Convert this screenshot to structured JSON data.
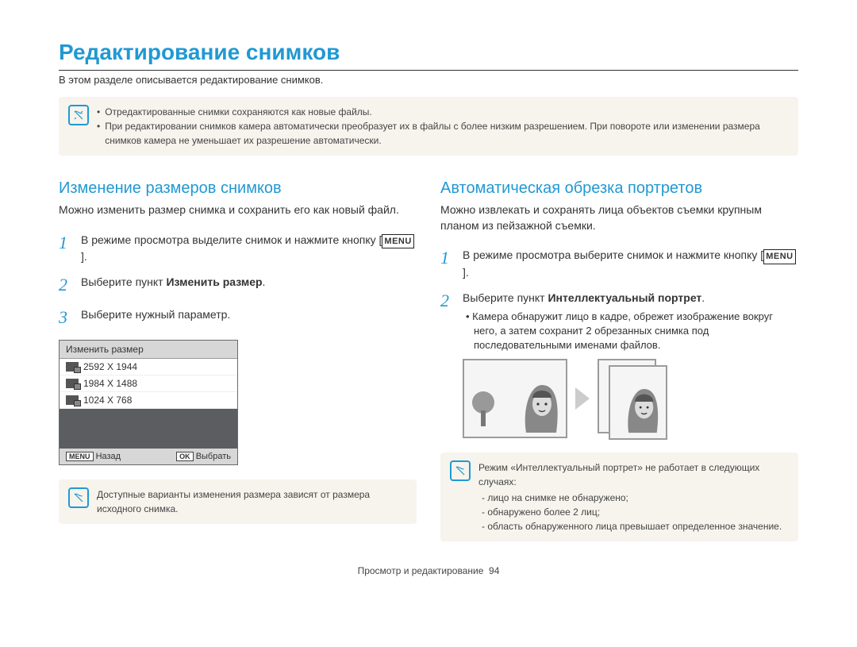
{
  "title": "Редактирование снимков",
  "subtitle": "В этом разделе описывается редактирование снимков.",
  "top_note": {
    "lines": [
      "Отредактированные снимки сохраняются как новые файлы.",
      "При редактировании снимков камера автоматически преобразует их в файлы с более низким разрешением. При повороте или изменении размера снимков камера не уменьшает их разрешение автоматически."
    ]
  },
  "left": {
    "heading": "Изменение размеров снимков",
    "lead": "Можно изменить размер снимка и сохранить его как новый файл.",
    "steps": [
      {
        "pre": "В режиме просмотра выделите снимок и нажмите кнопку [",
        "key": "MENU",
        "post": "]."
      },
      {
        "pre": "Выберите пункт ",
        "bold": "Изменить размер",
        "post": "."
      },
      {
        "pre": "Выберите нужный параметр."
      }
    ],
    "cam": {
      "title": "Изменить размер",
      "rows": [
        "2592 X 1944",
        "1984 X 1488",
        "1024 X 768"
      ],
      "foot_left_key": "MENU",
      "foot_left": "Назад",
      "foot_right_key": "OK",
      "foot_right": "Выбрать"
    },
    "note": "Доступные варианты изменения размера зависят от размера исходного снимка."
  },
  "right": {
    "heading": "Автоматическая обрезка портретов",
    "lead": "Можно извлекать и сохранять лица объектов съемки крупным планом из пейзажной съемки.",
    "steps": [
      {
        "pre": "В режиме просмотра выберите снимок и нажмите кнопку [",
        "key": "MENU",
        "post": "]."
      },
      {
        "pre": "Выберите пункт ",
        "bold": "Интеллектуальный портрет",
        "post": "."
      }
    ],
    "sub_bullet": "Камера обнаружит лицо в кадре, обрежет изображение вокруг него, а затем сохранит 2 обрезанных снимка под последовательными именами файлов.",
    "note_title": "Режим «Интеллектуальный портрет» не работает в следующих случаях:",
    "note_items": [
      "лицо на снимке не обнаружено;",
      "обнаружено более 2 лиц;",
      "область обнаруженного лица превышает определенное значение."
    ]
  },
  "footer": {
    "section": "Просмотр и редактирование",
    "page": "94"
  }
}
